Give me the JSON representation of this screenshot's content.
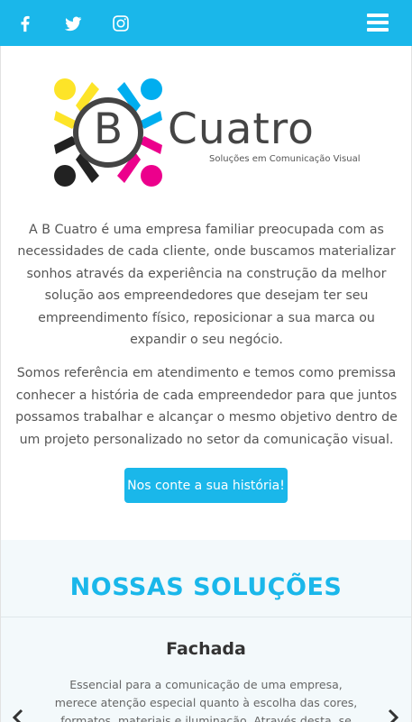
{
  "header": {
    "social_icons": [
      "facebook-icon",
      "twitter-icon",
      "instagram-icon"
    ],
    "menu_icon": "hamburger-menu-icon",
    "background_color": "#1ab7ea"
  },
  "logo": {
    "title": "B Cuatro",
    "title_c": "Cuatro",
    "title_b": "B",
    "subtitle": "Soluções em Comunicação Visual",
    "colors": [
      "#fde428",
      "#00aeef",
      "#ec008c",
      "#222222"
    ]
  },
  "about": {
    "paragraph_1": "A B Cuatro é uma empresa familiar preocupada com as necessidades de cada cliente, onde buscamos materializar sonhos através da experiência na construção da melhor solução aos empreendedores que desejam ter seu empreendimento físico, reposicionar a sua marca ou expandir o seu negócio.",
    "paragraph_2": "Somos referência em atendimento e temos como premissa conhecer a história de cada empreendedor para que juntos possamos trabalhar e alcançar o mesmo objetivo dentro de um projeto personalizado no setor da comunicação visual.",
    "cta_label": "Nos conte a sua história!"
  },
  "solutions": {
    "heading": "NOSSAS SOLUÇÕES",
    "card": {
      "title": "Fachada",
      "text": "Essencial para a comunicação de uma empresa, merece atenção especial quanto à escolha das cores, formatos, materiais e iluminação. Através desta, se tem a primeira"
    },
    "prev_icon": "chevron-left-icon",
    "next_icon": "chevron-right-icon"
  },
  "accent_color": "#1ab7ea"
}
